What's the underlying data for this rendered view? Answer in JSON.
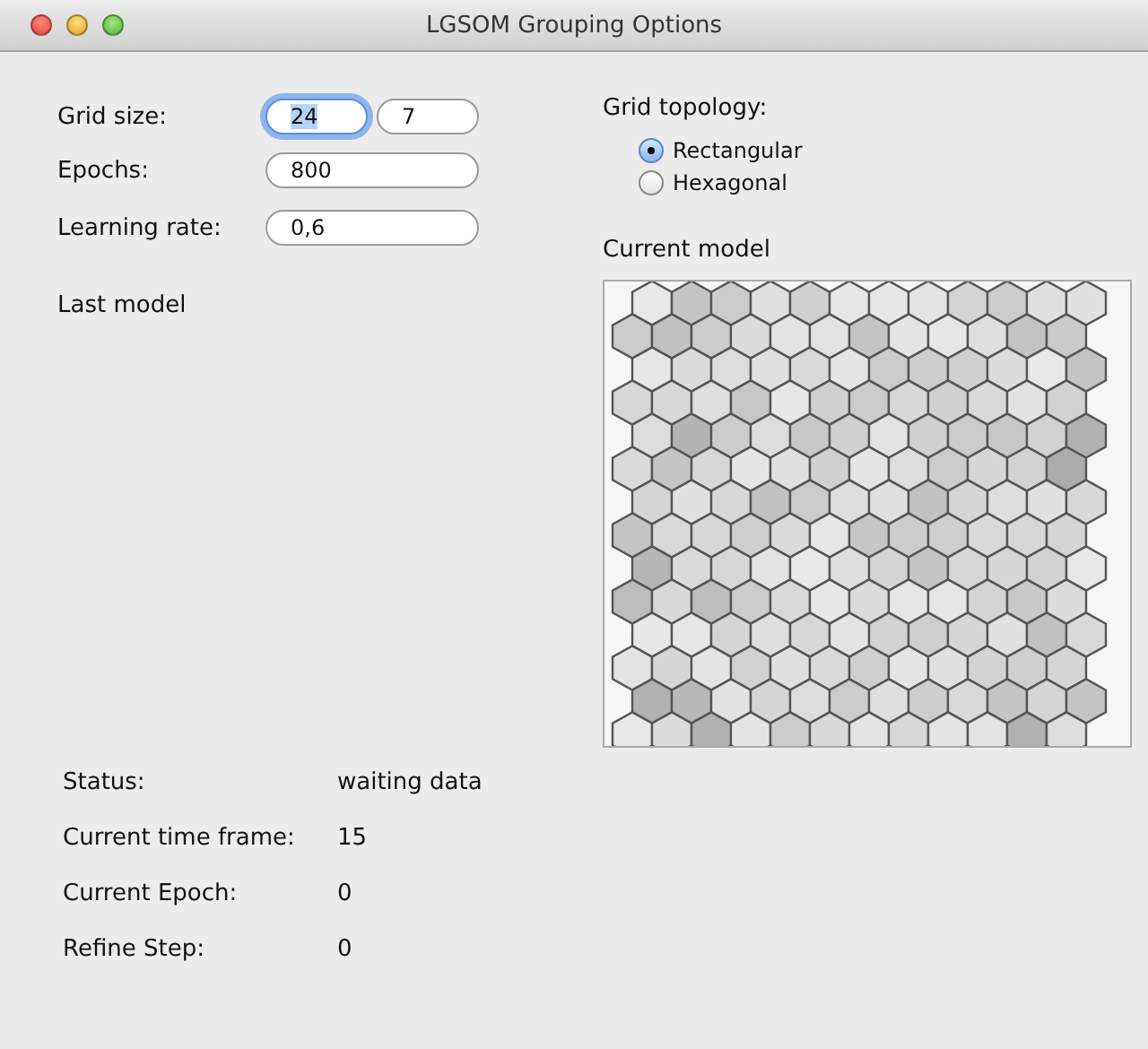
{
  "window": {
    "title": "LGSOM Grouping Options"
  },
  "fields": [
    {
      "label": "Grid size:",
      "inputs": [
        {
          "value": "24",
          "focused": true
        },
        {
          "value": "7",
          "focused": false
        }
      ]
    },
    {
      "label": "Epochs:",
      "inputs": [
        {
          "value": "800",
          "focused": false
        }
      ]
    },
    {
      "label": "Learning rate:",
      "inputs": [
        {
          "value": "0,6",
          "focused": false
        }
      ]
    }
  ],
  "topology": {
    "label": "Grid topology:",
    "options": [
      {
        "label": "Rectangular",
        "selected": true
      },
      {
        "label": "Hexagonal",
        "selected": false
      }
    ]
  },
  "last_model": {
    "title": "Last model"
  },
  "current_model": {
    "title": "Current model",
    "kind": "picture"
  },
  "status": [
    {
      "label": "Status:",
      "value": "waiting data"
    },
    {
      "label": "Current time frame:",
      "value": "15"
    },
    {
      "label": "Current Epoch:",
      "value": "0"
    },
    {
      "label": "Refine Step:",
      "value": "0"
    }
  ]
}
